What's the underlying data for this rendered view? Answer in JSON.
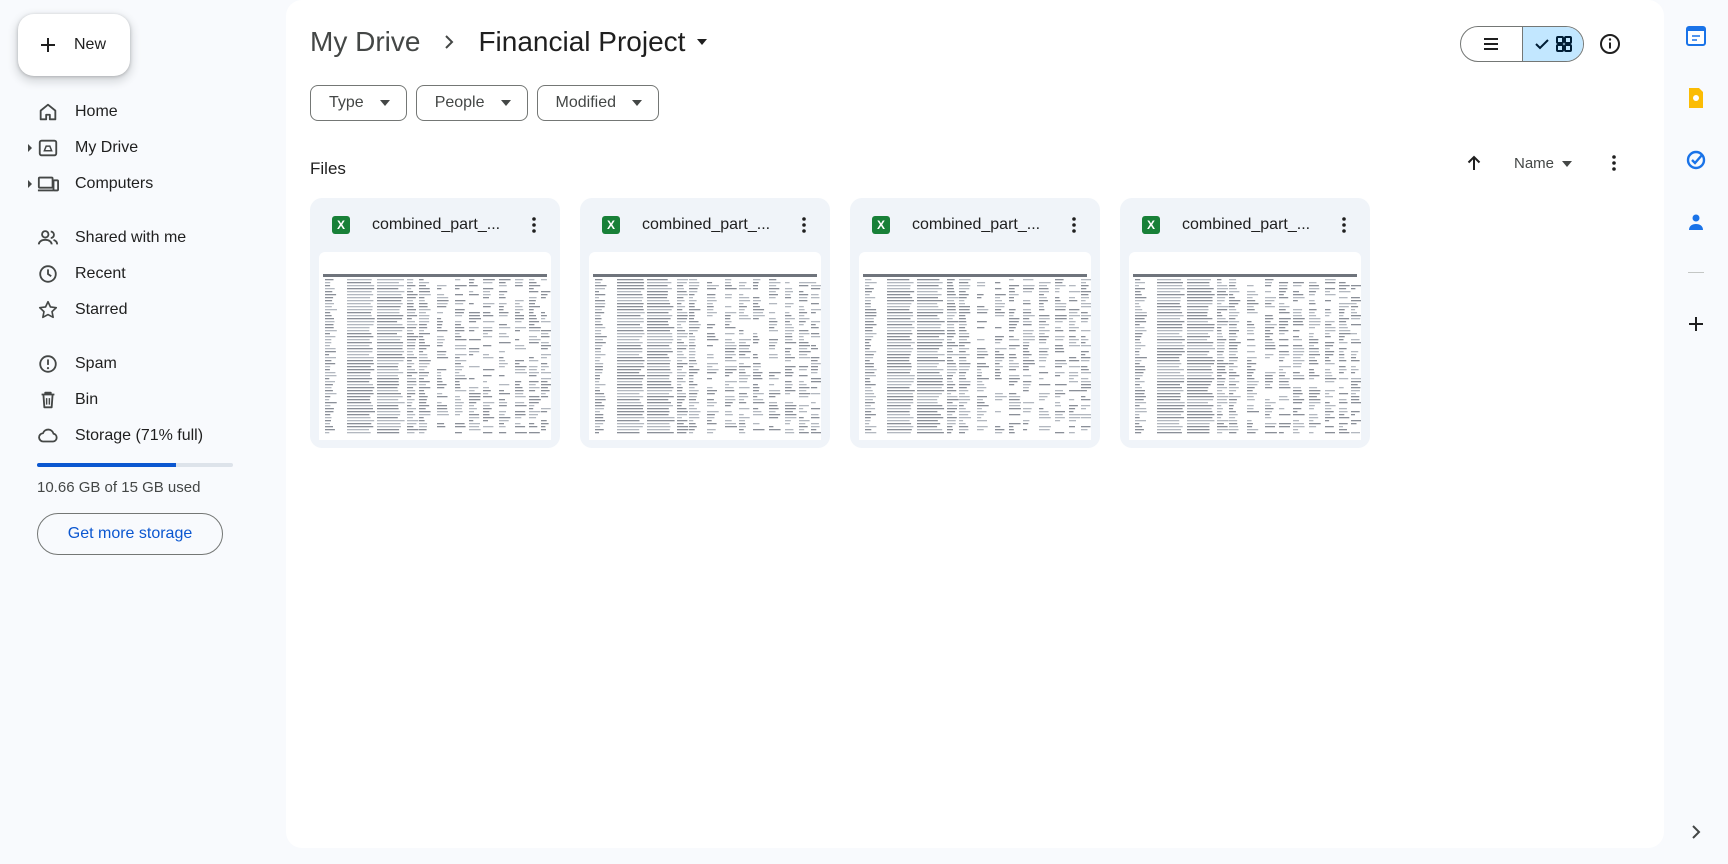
{
  "new_button": {
    "label": "New",
    "icon": "plus-icon"
  },
  "nav": {
    "home": "Home",
    "my_drive": "My Drive",
    "computers": "Computers",
    "shared": "Shared with me",
    "recent": "Recent",
    "starred": "Starred",
    "spam": "Spam",
    "bin": "Bin",
    "storage": "Storage (71% full)"
  },
  "storage": {
    "used_fraction": 0.71,
    "used_text": "10.66 GB of 15 GB used",
    "get_more_label": "Get more storage"
  },
  "breadcrumb": {
    "parent": "My Drive",
    "current": "Financial Project"
  },
  "filters": {
    "type": "Type",
    "people": "People",
    "modified": "Modified"
  },
  "files_section": {
    "label": "Files",
    "sort_label": "Name"
  },
  "files": [
    {
      "name": "combined_part_...",
      "type_icon": "X"
    },
    {
      "name": "combined_part_...",
      "type_icon": "X"
    },
    {
      "name": "combined_part_...",
      "type_icon": "X"
    },
    {
      "name": "combined_part_...",
      "type_icon": "X"
    }
  ],
  "colors": {
    "accent": "#0b57d0",
    "selected_toggle": "#c2e7ff",
    "sheets_green": "#188038",
    "card_bg": "#f0f4f9"
  },
  "rail_icons": [
    "calendar-icon",
    "keep-icon",
    "tasks-icon",
    "contacts-icon",
    "add-icon",
    "chevron-right-icon"
  ]
}
